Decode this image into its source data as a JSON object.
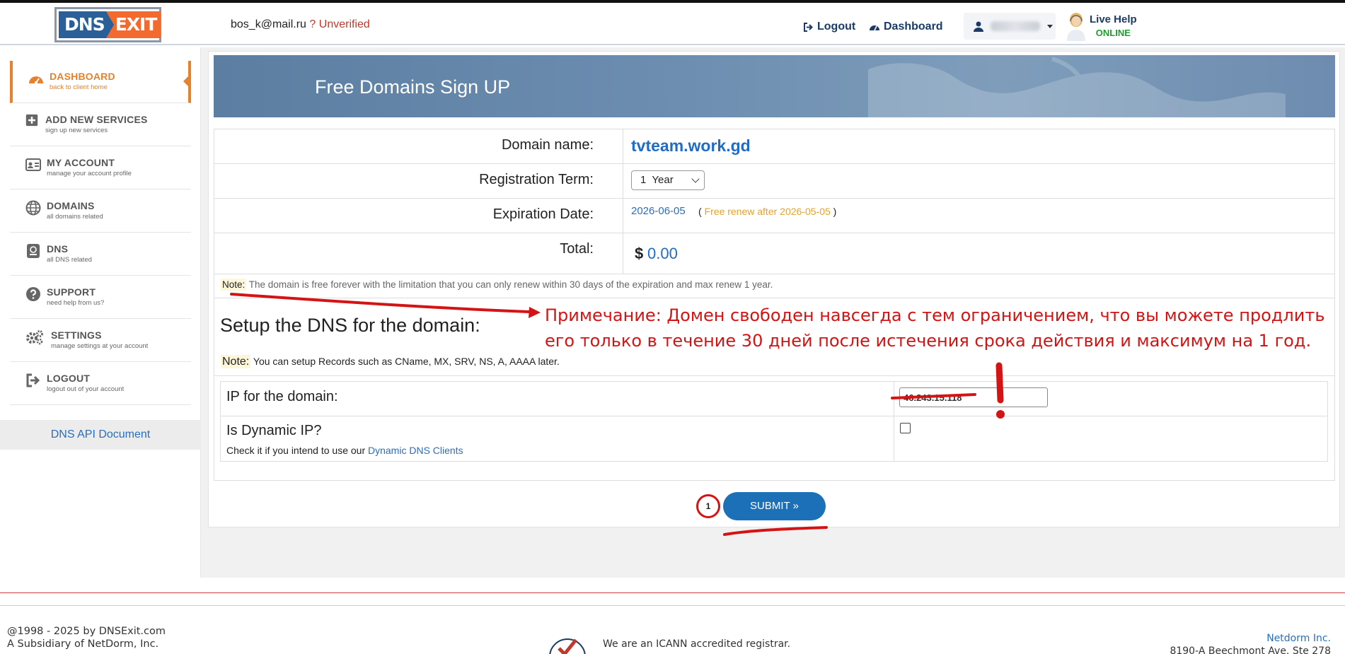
{
  "header": {
    "logo_left": "DNS",
    "logo_right": "EXIT",
    "email": "bos_k@mail.ru",
    "verify_mark": "?",
    "verify_status": "Unverified",
    "logout_label": "Logout",
    "dashboard_label": "Dashboard",
    "live_help_label": "Live Help",
    "live_help_status": "ONLINE"
  },
  "sidebar": {
    "items": [
      {
        "title": "DASHBOARD",
        "subtitle": "back to client home",
        "icon": "dashboard-icon",
        "active": true
      },
      {
        "title": "ADD NEW SERVICES",
        "subtitle": "sign up new services",
        "icon": "plus-square-icon"
      },
      {
        "title": "MY ACCOUNT",
        "subtitle": "manage your account profile",
        "icon": "id-card-icon"
      },
      {
        "title": "DOMAINS",
        "subtitle": "all domains related",
        "icon": "globe-icon"
      },
      {
        "title": "DNS",
        "subtitle": "all DNS related",
        "icon": "server-icon"
      },
      {
        "title": "SUPPORT",
        "subtitle": "need help from us?",
        "icon": "question-circle-icon"
      },
      {
        "title": "SETTINGS",
        "subtitle": "manage settings at your account",
        "icon": "gears-icon"
      },
      {
        "title": "LOGOUT",
        "subtitle": "logout out of your account",
        "icon": "sign-out-icon"
      }
    ],
    "api_doc_label": "DNS API Document"
  },
  "main": {
    "banner_title": "Free Domains Sign UP",
    "domain_label": "Domain name:",
    "domain_value": "tvteam.work.gd",
    "term_label": "Registration Term:",
    "term_value": "1  Year",
    "expiration_label": "Expiration Date:",
    "expiration_value": "2026-06-05",
    "renew_open": "(",
    "renew_text": "Free renew after 2026-05-05",
    "renew_close": ")",
    "total_label": "Total:",
    "currency": "$",
    "total_value": "0.00",
    "note_tag": "Note:",
    "note_text": "The domain is free forever with the limitation that you can only renew within 30 days of the expiration and max renew 1 year.",
    "setup_heading": "Setup the DNS for the domain:",
    "note2_tag": "Note:",
    "note2_text": "You can setup Records such as CName, MX, SRV, NS, A, AAAA later.",
    "ip_label": "IP for the domain:",
    "ip_value": "46.243.15.118",
    "dynamic_label": "Is Dynamic IP?",
    "dynamic_hint": "Check it if you intend to use our",
    "dynamic_link": "Dynamic DNS Clients",
    "submit_label": "SUBMIT »"
  },
  "annotations": {
    "russian_note": "Примечание: Домен свободен навсегда с тем ограничением, что вы можете продлить его только в течение 30 дней после истечения срока действия и максимум на 1 год.",
    "step_number": "1",
    "exclamation": "!"
  },
  "footer": {
    "copyright": "@1998 - 2025 by DNSExit.com",
    "subsidiary": "A Subsidiary of NetDorm, Inc.",
    "icann_text": "We are an ICANN accredited registrar.",
    "company": "Netdorm Inc.",
    "address": "8190-A Beechmont Ave. Ste 278"
  },
  "colors": {
    "accent_orange": "#e5822e",
    "link_blue": "#2a6ebb",
    "submit_blue": "#1c70b7",
    "annotation_red": "#d41414"
  }
}
